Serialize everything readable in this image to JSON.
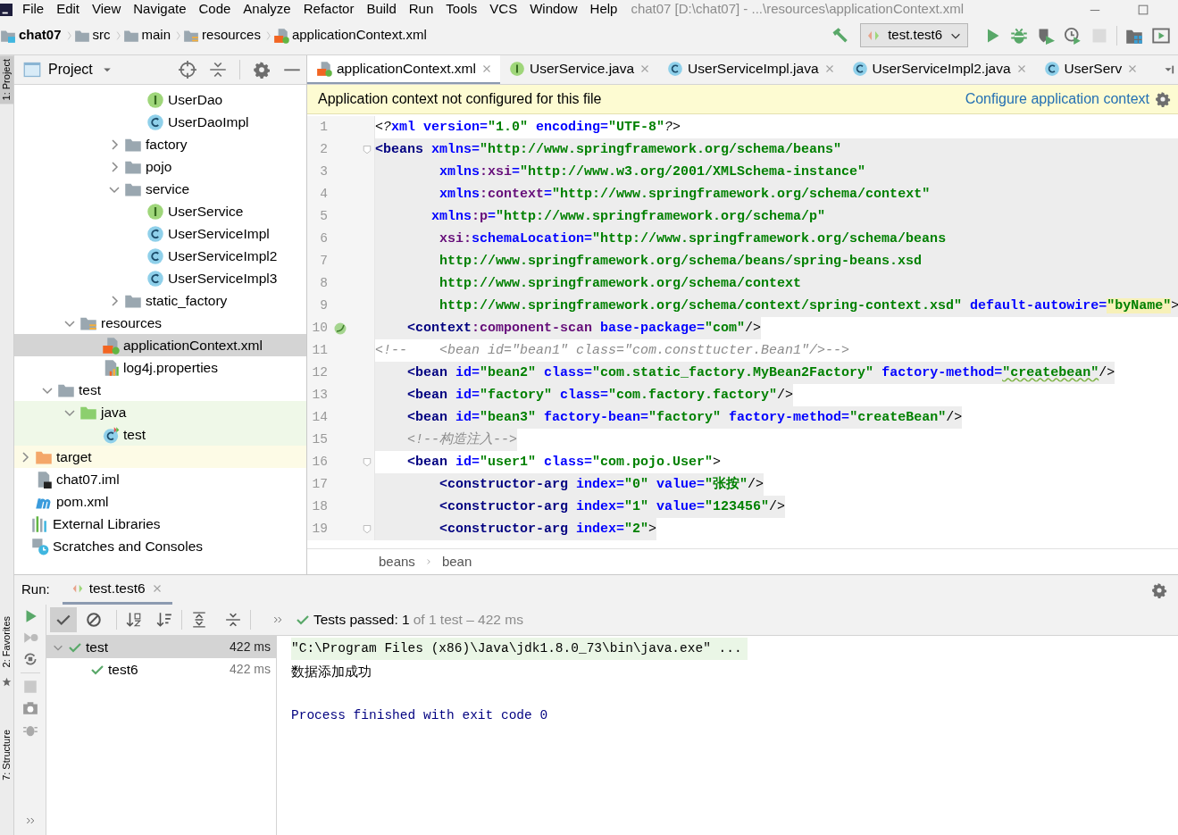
{
  "window": {
    "title": "chat07 [D:\\chat07] - ...\\resources\\applicationContext.xml"
  },
  "menu": [
    "File",
    "Edit",
    "View",
    "Navigate",
    "Code",
    "Analyze",
    "Refactor",
    "Build",
    "Run",
    "Tools",
    "VCS",
    "Window",
    "Help"
  ],
  "breadcrumbs": [
    {
      "label": "chat07",
      "kind": "module"
    },
    {
      "label": "src",
      "kind": "folder"
    },
    {
      "label": "main",
      "kind": "folder"
    },
    {
      "label": "resources",
      "kind": "resources"
    },
    {
      "label": "applicationContext.xml",
      "kind": "xml"
    }
  ],
  "toolbar": {
    "run_config": "test.test6",
    "buttons": [
      {
        "kind": "build",
        "disabled": false
      },
      {
        "kind": "run",
        "disabled": false
      },
      {
        "kind": "debug",
        "disabled": false
      },
      {
        "kind": "coverage",
        "disabled": false
      },
      {
        "kind": "profile",
        "disabled": false
      },
      {
        "kind": "stop",
        "disabled": true
      },
      {
        "kind": "structure",
        "disabled": false
      },
      {
        "kind": "run-window",
        "disabled": false
      }
    ]
  },
  "side_strip": [
    {
      "label": "1: Project",
      "selected": true
    },
    {
      "label": "2: Favorites",
      "selected": false
    },
    {
      "label": "7: Structure",
      "selected": false
    }
  ],
  "project_panel": {
    "title": "Project",
    "tree": [
      {
        "children": [
          {
            "children": [
              {
                "children": [
                  {
                    "children": [
                      {
                        "children": [
                          {
                            "children": [
                              {
                                "label": "UserDao",
                                "kind": "interface",
                                "selected": false
                              },
                              {
                                "label": "UserDaoImpl",
                                "kind": "class",
                                "selected": false
                              }
                            ]
                          },
                          {
                            "label": "factory",
                            "kind": "folder",
                            "expanded": false,
                            "selected": false
                          },
                          {
                            "label": "pojo",
                            "kind": "folder",
                            "expanded": false,
                            "selected": false
                          },
                          {
                            "label": "service",
                            "kind": "folder",
                            "expanded": true,
                            "selected": false,
                            "children": [
                              {
                                "label": "UserService",
                                "kind": "interface",
                                "selected": false
                              },
                              {
                                "label": "UserServiceImpl",
                                "kind": "class",
                                "selected": false
                              },
                              {
                                "label": "UserServiceImpl2",
                                "kind": "class",
                                "selected": false
                              },
                              {
                                "label": "UserServiceImpl3",
                                "kind": "class",
                                "selected": false
                              }
                            ]
                          },
                          {
                            "label": "static_factory",
                            "kind": "folder",
                            "expanded": false,
                            "selected": false
                          }
                        ]
                      }
                    ]
                  },
                  {
                    "label": "resources",
                    "kind": "resources",
                    "expanded": true,
                    "selected": false,
                    "children": [
                      {
                        "label": "applicationContext.xml",
                        "kind": "xml",
                        "selected": true
                      },
                      {
                        "label": "log4j.properties",
                        "kind": "properties",
                        "selected": false
                      }
                    ]
                  }
                ]
              },
              {
                "label": "test",
                "kind": "folder",
                "expanded": true,
                "selected": false,
                "children": [
                  {
                    "label": "java",
                    "kind": "test-folder",
                    "expanded": true,
                    "selected": false,
                    "children": [
                      {
                        "label": "test",
                        "kind": "test-class",
                        "selected": false
                      }
                    ]
                  }
                ]
              }
            ]
          },
          {
            "label": "target",
            "kind": "excluded-folder",
            "expanded": false,
            "selected": false
          },
          {
            "label": "chat07.iml",
            "kind": "iml",
            "selected": false
          },
          {
            "label": "pom.xml",
            "kind": "maven",
            "selected": false
          }
        ]
      },
      {
        "label": "External Libraries",
        "kind": "libraries",
        "selected": false
      },
      {
        "label": "Scratches and Consoles",
        "kind": "scratches",
        "selected": false
      }
    ]
  },
  "editor": {
    "tabs": [
      {
        "label": "applicationContext.xml",
        "kind": "xml",
        "selected": true
      },
      {
        "label": "UserService.java",
        "kind": "interface",
        "selected": false
      },
      {
        "label": "UserServiceImpl.java",
        "kind": "class",
        "selected": false
      },
      {
        "label": "UserServiceImpl2.java",
        "kind": "class",
        "selected": false
      },
      {
        "label": "UserServ",
        "kind": "class",
        "selected": false
      }
    ],
    "banner": {
      "message": "Application context not configured for this file",
      "link": "Configure application context"
    },
    "lines": [
      {
        "number": "1",
        "kind": "plain",
        "fold": false,
        "marker": false,
        "tokens": [
          {
            "kind": "pi",
            "text": "<?"
          },
          {
            "kind": "attr",
            "text": "xml version="
          },
          {
            "kind": "str",
            "text": "\"1.0\""
          },
          {
            "kind": "attr",
            "text": " encoding="
          },
          {
            "kind": "str",
            "text": "\"UTF-8\""
          },
          {
            "kind": "pi",
            "text": "?>"
          }
        ]
      },
      {
        "number": "2",
        "kind": "block",
        "fold": true,
        "marker": false,
        "tokens": [
          {
            "kind": "tag",
            "text": "<beans"
          },
          {
            "kind": "attr",
            "text": " xmlns="
          },
          {
            "kind": "str",
            "text": "\"http://www.springframework.org/schema/beans\""
          }
        ]
      },
      {
        "number": "3",
        "kind": "block",
        "fold": false,
        "marker": false,
        "tokens": [
          {
            "kind": "attr",
            "text": "        xmlns"
          },
          {
            "kind": "ns",
            "text": ":xsi"
          },
          {
            "kind": "attr",
            "text": "="
          },
          {
            "kind": "str",
            "text": "\"http://www.w3.org/2001/XMLSchema-instance\""
          }
        ]
      },
      {
        "number": "4",
        "kind": "block",
        "fold": false,
        "marker": false,
        "tokens": [
          {
            "kind": "attr",
            "text": "        xmlns"
          },
          {
            "kind": "ns",
            "text": ":context"
          },
          {
            "kind": "attr",
            "text": "="
          },
          {
            "kind": "str",
            "text": "\"http://www.springframework.org/schema/context\""
          }
        ]
      },
      {
        "number": "5",
        "kind": "block",
        "fold": false,
        "marker": false,
        "tokens": [
          {
            "kind": "attr",
            "text": "       xmlns"
          },
          {
            "kind": "ns",
            "text": ":p"
          },
          {
            "kind": "attr",
            "text": "="
          },
          {
            "kind": "str",
            "text": "\"http://www.springframework.org/schema/p\""
          }
        ]
      },
      {
        "number": "6",
        "kind": "block",
        "fold": false,
        "marker": false,
        "tokens": [
          {
            "kind": "ns",
            "text": "        xsi:"
          },
          {
            "kind": "attr",
            "text": "schemaLocation="
          },
          {
            "kind": "str",
            "text": "\"http://www.springframework.org/schema/beans"
          }
        ]
      },
      {
        "number": "7",
        "kind": "block",
        "fold": false,
        "marker": false,
        "tokens": [
          {
            "kind": "str",
            "text": "        http://www.springframework.org/schema/beans/spring-beans.xsd"
          }
        ]
      },
      {
        "number": "8",
        "kind": "block",
        "fold": false,
        "marker": false,
        "tokens": [
          {
            "kind": "str",
            "text": "        http://www.springframework.org/schema/context"
          }
        ]
      },
      {
        "number": "9",
        "kind": "block",
        "fold": false,
        "marker": false,
        "tokens": [
          {
            "kind": "str",
            "text": "        http://www.springframework.org/schema/context/spring-context.xsd\""
          },
          {
            "kind": "attr",
            "text": " default-autowire="
          },
          {
            "kind": "match",
            "text": "\"byName\""
          },
          {
            "kind": "plain",
            "text": ">"
          }
        ]
      },
      {
        "number": "10",
        "kind": "shaded",
        "fold": false,
        "marker": true,
        "tokens": [
          {
            "kind": "tag",
            "text": "    <context"
          },
          {
            "kind": "ns",
            "text": ":component-scan"
          },
          {
            "kind": "attr",
            "text": " base-package="
          },
          {
            "kind": "str",
            "text": "\"com\""
          },
          {
            "kind": "plain",
            "text": "/>"
          }
        ]
      },
      {
        "number": "11",
        "kind": "plain",
        "fold": false,
        "marker": false,
        "tokens": [
          {
            "kind": "comment",
            "text": "<!--    <bean id=\"bean1\" class=\"com.consttucter.Bean1\"/>-->"
          }
        ]
      },
      {
        "number": "12",
        "kind": "shaded",
        "fold": false,
        "marker": false,
        "tokens": [
          {
            "kind": "tag",
            "text": "    <bean"
          },
          {
            "kind": "attr",
            "text": " id="
          },
          {
            "kind": "str",
            "text": "\"bean2\""
          },
          {
            "kind": "attr",
            "text": " class="
          },
          {
            "kind": "str",
            "text": "\"com.static_factory.MyBean2Factory\""
          },
          {
            "kind": "attr",
            "text": " factory-method="
          },
          {
            "kind": "typo",
            "text": "\"createbean\""
          },
          {
            "kind": "plain",
            "text": "/>"
          }
        ]
      },
      {
        "number": "13",
        "kind": "shaded",
        "fold": false,
        "marker": false,
        "tokens": [
          {
            "kind": "tag",
            "text": "    <bean"
          },
          {
            "kind": "attr",
            "text": " id="
          },
          {
            "kind": "str",
            "text": "\"factory\""
          },
          {
            "kind": "attr",
            "text": " class="
          },
          {
            "kind": "str",
            "text": "\"com.factory.factory\""
          },
          {
            "kind": "plain",
            "text": "/>"
          }
        ]
      },
      {
        "number": "14",
        "kind": "shaded",
        "fold": false,
        "marker": false,
        "tokens": [
          {
            "kind": "tag",
            "text": "    <bean"
          },
          {
            "kind": "attr",
            "text": " id="
          },
          {
            "kind": "str",
            "text": "\"bean3\""
          },
          {
            "kind": "attr",
            "text": " factory-bean="
          },
          {
            "kind": "str",
            "text": "\"factory\""
          },
          {
            "kind": "attr",
            "text": " factory-method="
          },
          {
            "kind": "str",
            "text": "\"createBean\""
          },
          {
            "kind": "plain",
            "text": "/>"
          }
        ]
      },
      {
        "number": "15",
        "kind": "shaded",
        "fold": false,
        "marker": false,
        "tokens": [
          {
            "kind": "comment",
            "text": "    <!--构造注入-->"
          }
        ]
      },
      {
        "number": "16",
        "kind": "plain",
        "fold": true,
        "marker": false,
        "tokens": [
          {
            "kind": "tag",
            "text": "    <bean"
          },
          {
            "kind": "attr",
            "text": " id="
          },
          {
            "kind": "str",
            "text": "\"user1\""
          },
          {
            "kind": "attr",
            "text": " class="
          },
          {
            "kind": "str",
            "text": "\"com.pojo.User\""
          },
          {
            "kind": "plain",
            "text": ">"
          }
        ]
      },
      {
        "number": "17",
        "kind": "shaded",
        "fold": false,
        "marker": false,
        "tokens": [
          {
            "kind": "tag",
            "text": "        <constructor-arg"
          },
          {
            "kind": "attr",
            "text": " index="
          },
          {
            "kind": "str",
            "text": "\"0\""
          },
          {
            "kind": "attr",
            "text": " value="
          },
          {
            "kind": "str",
            "text": "\"张按\""
          },
          {
            "kind": "plain",
            "text": "/>"
          }
        ]
      },
      {
        "number": "18",
        "kind": "shaded",
        "fold": false,
        "marker": false,
        "tokens": [
          {
            "kind": "tag",
            "text": "        <constructor-arg"
          },
          {
            "kind": "attr",
            "text": " index="
          },
          {
            "kind": "str",
            "text": "\"1\""
          },
          {
            "kind": "attr",
            "text": " value="
          },
          {
            "kind": "str",
            "text": "\"123456\""
          },
          {
            "kind": "plain",
            "text": "/>"
          }
        ]
      },
      {
        "number": "19",
        "kind": "shaded",
        "fold": true,
        "marker": false,
        "tokens": [
          {
            "kind": "tag",
            "text": "        <constructor-arg"
          },
          {
            "kind": "attr",
            "text": " index="
          },
          {
            "kind": "str",
            "text": "\"2\""
          },
          {
            "kind": "plain",
            "text": ">"
          }
        ]
      }
    ],
    "path": [
      "beans",
      "bean"
    ]
  },
  "run_panel": {
    "label": "Run:",
    "tab": {
      "label": "test.test6",
      "selected": true
    },
    "filters": [
      {
        "kind": "passed",
        "selected": true
      },
      {
        "kind": "ignored",
        "selected": false
      }
    ],
    "status": {
      "passed": "Tests passed: 1",
      "detail": "of 1 test – 422 ms"
    },
    "tests": [
      {
        "label": "test",
        "time": "422 ms",
        "selected": true,
        "expanded": true,
        "children": [
          {
            "label": "test6",
            "time": "422 ms",
            "selected": false
          }
        ]
      }
    ],
    "console": [
      {
        "kind": "command",
        "text": "\"C:\\Program Files (x86)\\Java\\jdk1.8.0_73\\bin\\java.exe\" ..."
      },
      {
        "kind": "output",
        "text": "数据添加成功"
      },
      {
        "kind": "exit",
        "text": "Process finished with exit code 0"
      }
    ]
  }
}
